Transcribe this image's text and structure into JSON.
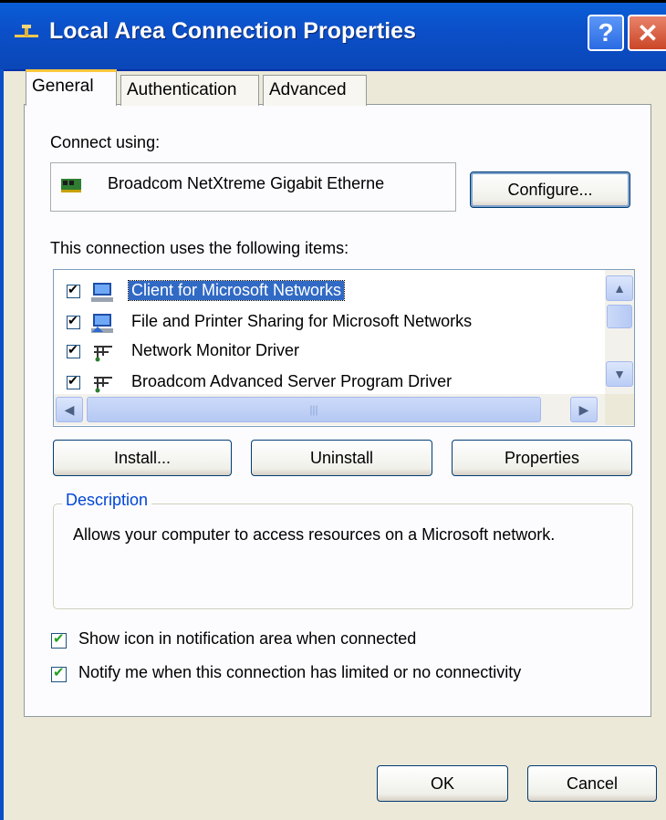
{
  "window": {
    "title": "Local Area Connection Properties",
    "help_label": "?",
    "close_label": "✕"
  },
  "tabs": [
    {
      "label": "General",
      "active": true
    },
    {
      "label": "Authentication",
      "active": false
    },
    {
      "label": "Advanced",
      "active": false
    }
  ],
  "general": {
    "connect_using_label": "Connect using:",
    "adapter_name": "Broadcom NetXtreme Gigabit Etherne",
    "configure_button": "Configure...",
    "items_label": "This connection uses the following items:",
    "items": [
      {
        "label": "Client for Microsoft Networks",
        "checked": true,
        "selected": true,
        "icon": "network-client-icon"
      },
      {
        "label": "File and Printer Sharing for Microsoft Networks",
        "checked": true,
        "selected": false,
        "icon": "file-printer-sharing-icon"
      },
      {
        "label": "Network Monitor Driver",
        "checked": true,
        "selected": false,
        "icon": "network-service-icon"
      },
      {
        "label": "Broadcom Advanced Server Program Driver",
        "checked": true,
        "selected": false,
        "icon": "network-service-icon"
      }
    ],
    "install_button": "Install...",
    "uninstall_button": "Uninstall",
    "properties_button": "Properties",
    "description_title": "Description",
    "description_text": "Allows your computer to access resources on a Microsoft network.",
    "show_icon_label": "Show icon in notification area when connected",
    "show_icon_checked": true,
    "notify_label": "Notify me when this connection has limited or no connectivity",
    "notify_checked": true
  },
  "footer": {
    "ok_button": "OK",
    "cancel_button": "Cancel"
  },
  "colors": {
    "titlebar": "#0A5FD9",
    "dialog_bg": "#ECE9D8",
    "selection": "#316AC5",
    "group_title": "#0046D5",
    "check_green": "#21A121"
  }
}
